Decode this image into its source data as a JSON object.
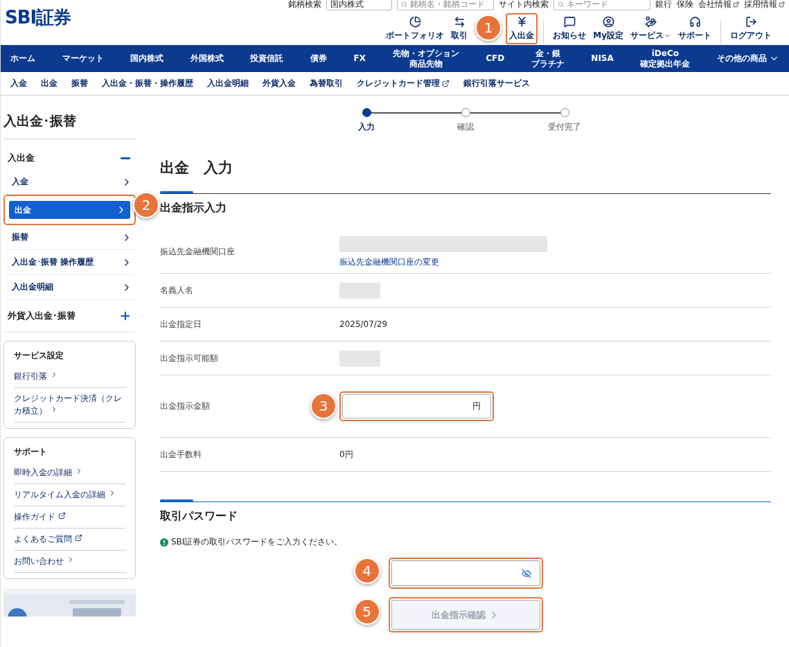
{
  "header": {
    "logo": "SBI証券",
    "utility": [
      {
        "kind": "label",
        "text": "銘柄検索"
      },
      {
        "kind": "select",
        "text": "国内株式"
      },
      {
        "kind": "search",
        "text": "銘柄名・銘柄コード"
      },
      {
        "kind": "label",
        "text": "サイト内検索"
      },
      {
        "kind": "search",
        "text": "キーワード"
      },
      {
        "kind": "link",
        "text": "銀行"
      },
      {
        "kind": "link",
        "text": "保険"
      },
      {
        "kind": "external",
        "text": "会社情報"
      },
      {
        "kind": "external",
        "text": "採用情報"
      }
    ],
    "icons": [
      {
        "kind": "pie",
        "label": "ポートフォリオ"
      },
      {
        "kind": "arrows",
        "label": "取引"
      },
      {
        "kind": "yen",
        "label": "入出金",
        "callout": "1"
      },
      {
        "kind": "bubble",
        "label": "お知らせ"
      },
      {
        "kind": "user",
        "label": "My設定"
      },
      {
        "kind": "hand",
        "label": "サービス",
        "caret": true
      },
      {
        "kind": "headset",
        "label": "サポート"
      },
      {
        "kind": "logout",
        "label": "ログアウト"
      }
    ]
  },
  "nav": [
    {
      "lines": [
        "ホーム"
      ]
    },
    {
      "lines": [
        "マーケット"
      ]
    },
    {
      "lines": [
        "国内株式"
      ]
    },
    {
      "lines": [
        "外国株式"
      ]
    },
    {
      "lines": [
        "投資信託"
      ]
    },
    {
      "lines": [
        "債券"
      ]
    },
    {
      "lines": [
        "FX"
      ]
    },
    {
      "lines": [
        "先物・オプション",
        "商品先物"
      ]
    },
    {
      "lines": [
        "CFD"
      ]
    },
    {
      "lines": [
        "金・銀",
        "プラチナ"
      ]
    },
    {
      "lines": [
        "NISA"
      ]
    },
    {
      "lines": [
        "iDeCo",
        "確定拠出年金"
      ]
    },
    {
      "lines": [
        "その他の商品"
      ],
      "caret": true
    }
  ],
  "subnav": [
    {
      "label": "入金",
      "external": false
    },
    {
      "label": "出金",
      "external": false
    },
    {
      "label": "振替",
      "external": false
    },
    {
      "label": "入出金・振替・操作履歴",
      "external": false
    },
    {
      "label": "入出金明細",
      "external": false
    },
    {
      "label": "外貨入金",
      "external": false
    },
    {
      "label": "為替取引",
      "external": false
    },
    {
      "label": "クレジットカード管理",
      "external": true
    },
    {
      "label": "銀行引落サービス",
      "external": false
    }
  ],
  "sidebar": {
    "title": "入出金･振替",
    "groups": [
      {
        "label": "入出金",
        "expanded": true,
        "items": [
          {
            "label": "入金",
            "selected": false
          },
          {
            "label": "出金",
            "selected": true,
            "callout": "2"
          },
          {
            "label": "振替",
            "selected": false
          },
          {
            "label": "入出金･振替 操作履歴",
            "selected": false
          },
          {
            "label": "入出金明細",
            "selected": false
          }
        ]
      },
      {
        "label": "外貨入出金･振替",
        "expanded": false
      }
    ],
    "boxes": [
      {
        "title": "サービス設定",
        "links": [
          {
            "label": "銀行引落",
            "external": false
          },
          {
            "label": "クレジットカード決済（クレカ積立）",
            "external": false
          }
        ]
      },
      {
        "title": "サポート",
        "links": [
          {
            "label": "即時入金の詳細",
            "external": false
          },
          {
            "label": "リアルタイム入金の詳細",
            "external": false
          },
          {
            "label": "操作ガイド",
            "external": true
          },
          {
            "label": "よくあるご質問",
            "external": true
          },
          {
            "label": "お問い合わせ",
            "external": false
          }
        ]
      }
    ]
  },
  "steps": [
    {
      "label": "入力",
      "selected": true
    },
    {
      "label": "確認",
      "selected": false
    },
    {
      "label": "受付完了",
      "selected": false
    }
  ],
  "page_title": "出金　入力",
  "form": {
    "title": "出金指示入力",
    "rows": [
      {
        "label": "振込先金融機関口座",
        "kind": "redacted",
        "link": "振込先金融機関口座の変更"
      },
      {
        "label": "名義人名",
        "kind": "redacted"
      },
      {
        "label": "出金指定日",
        "kind": "text",
        "value": "2025/07/29"
      },
      {
        "label": "出金指示可能額",
        "kind": "redacted"
      },
      {
        "label": "出金指示金額",
        "kind": "amount",
        "unit": "円",
        "callout": "3"
      },
      {
        "label": "出金手数料",
        "kind": "text",
        "value": "0円"
      }
    ]
  },
  "password": {
    "title": "取引パスワード",
    "note": "SBI証券の取引パスワードをご入力ください。",
    "field_callout": "4",
    "button": {
      "label": "出金指示確認",
      "disabled": true,
      "callout": "5"
    }
  }
}
